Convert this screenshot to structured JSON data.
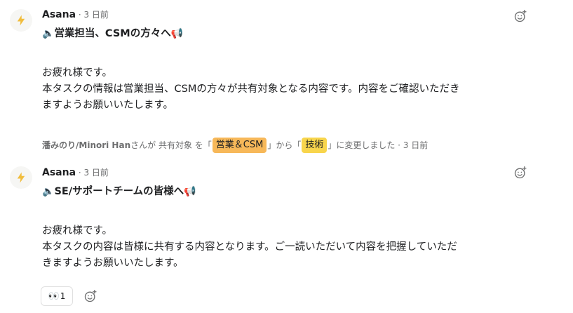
{
  "comments": [
    {
      "author": "Asana",
      "meta": " · 3 日前",
      "title_icon_left": "🔈",
      "title": "営業担当、CSMの方々へ",
      "title_icon_right": "📢",
      "body": [
        "お疲れ様です。",
        "本タスクの情報は営業担当、CSMの方々が共有対象となる内容です。内容をご確認いただき",
        "ますようお願いいたします。"
      ]
    },
    {
      "author": "Asana",
      "meta": " · 3 日前",
      "title_icon_left": "🔈",
      "title": "SE/サポートチームの皆様へ",
      "title_icon_right": "📢",
      "body": [
        "お疲れ様です。",
        "本タスクの内容は皆様に共有する内容となります。ご一読いただいて内容を把握していただ",
        "きますようお願いいたします。"
      ]
    }
  ],
  "change_event": {
    "who": "潘みのり/Minori Han",
    "text1": " さんが 共有対象 を「",
    "tag_old": "営業＆CSM",
    "text2": "」から「",
    "tag_new": "技術",
    "text3": "」に変更しました · 3 日前",
    "tag_old_color": "#f7b859",
    "tag_new_color": "#f8d54c"
  },
  "reaction": {
    "emoji": "👀",
    "count": "1"
  },
  "colors": {
    "asana_bolt": "#f1bd3e",
    "muted": "#6d6e6f"
  },
  "icons": {
    "avatar": "lightning-bolt-icon",
    "add_reaction": "smiley-plus-icon"
  }
}
